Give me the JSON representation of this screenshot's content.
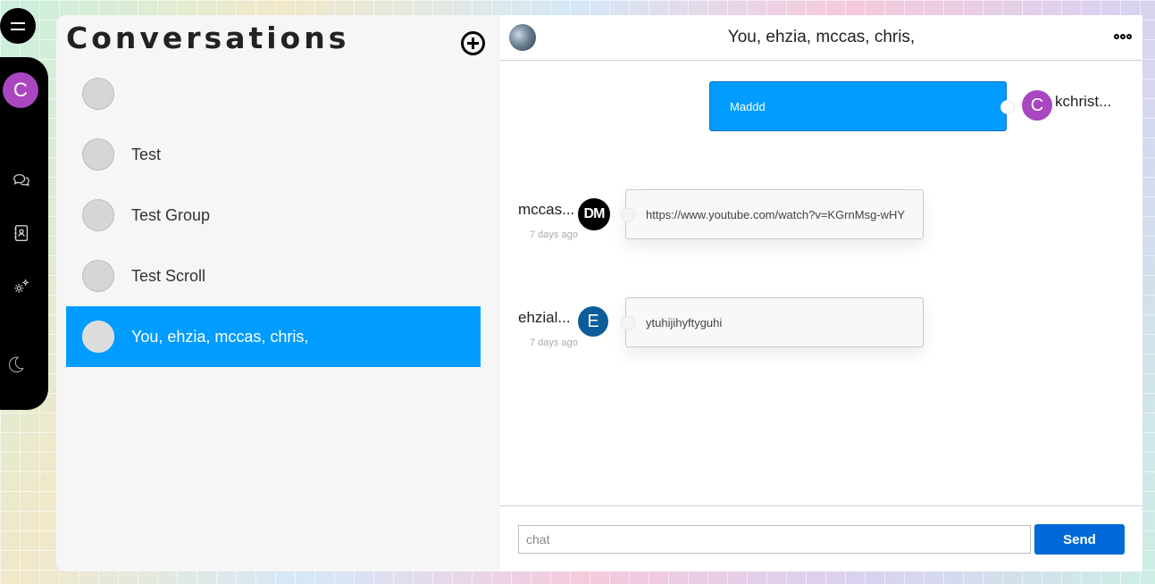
{
  "user": {
    "initial": "C"
  },
  "conversations": {
    "title": "Conversations",
    "items": [
      {
        "name": ""
      },
      {
        "name": "Test"
      },
      {
        "name": "Test Group"
      },
      {
        "name": "Test Scroll"
      },
      {
        "name": "You, ehzia, mccas, chris,",
        "active": true
      }
    ]
  },
  "chat": {
    "title": "You, ehzia, mccas, chris,",
    "messages": [
      {
        "sender": "kchrist...",
        "avatar_initial": "C",
        "avatar_color": "#a946c0",
        "text": "Maddd",
        "outgoing": true
      },
      {
        "sender": "mccas...",
        "avatar_initial": "DM",
        "avatar_color": "#000000",
        "text": "https://www.youtube.com/watch?v=KGrnMsg-wHY",
        "time": "7 days ago"
      },
      {
        "sender": "ehzial...",
        "avatar_initial": "E",
        "avatar_color": "#0d5c9a",
        "text": "ytuhijihyftyguhi",
        "time": "7 days ago"
      }
    ],
    "input_placeholder": "chat",
    "send_label": "Send"
  },
  "colors": {
    "accent": "#009cff",
    "send": "#0069d9"
  }
}
